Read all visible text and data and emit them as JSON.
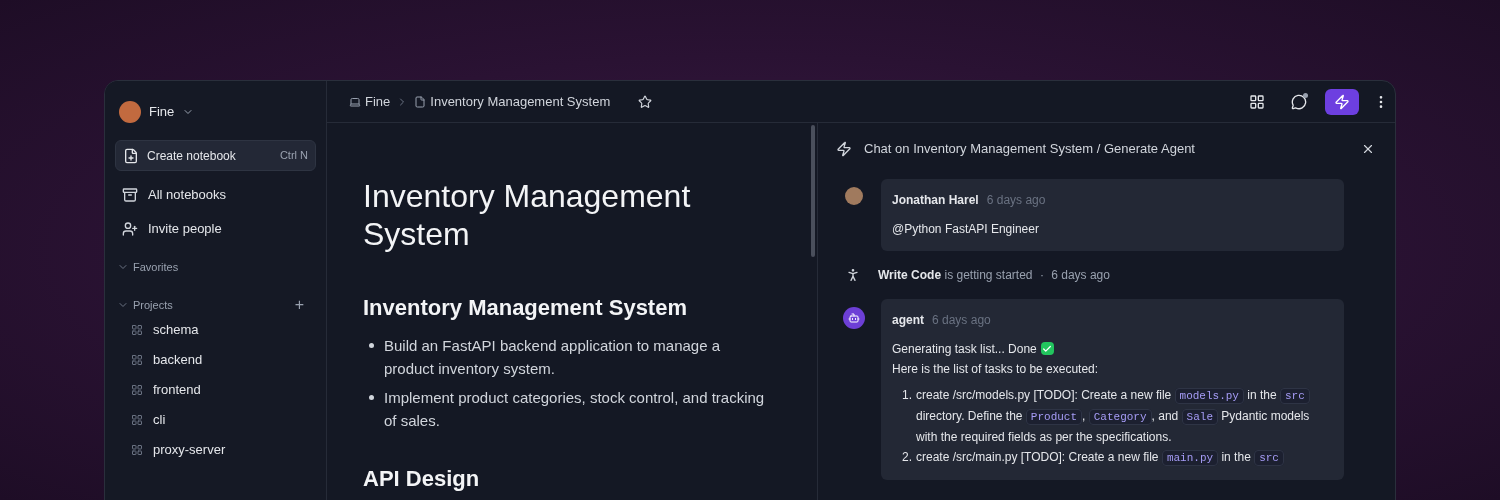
{
  "sidebar": {
    "workspace": "Fine",
    "create_button": {
      "label": "Create notebook",
      "shortcut": "Ctrl N"
    },
    "nav": [
      {
        "label": "All notebooks",
        "kind": "notebooks"
      },
      {
        "label": "Invite people",
        "kind": "invite"
      }
    ],
    "sections": [
      {
        "label": "Favorites",
        "expanded": true
      },
      {
        "label": "Projects",
        "expanded": true,
        "add": "+",
        "items": [
          "schema",
          "backend",
          "frontend",
          "cli",
          "proxy-server"
        ]
      }
    ]
  },
  "breadcrumb": [
    {
      "label": "Fine",
      "kind": "workspace"
    },
    {
      "label": "Inventory Management System",
      "kind": "page"
    }
  ],
  "document": {
    "title": "Inventory Management System",
    "sections": [
      {
        "heading": "Inventory Management System",
        "bullets": [
          "Build an FastAPI backend application to manage a product inventory system.",
          "Implement product categories, stock control, and tracking of sales."
        ]
      },
      {
        "heading": "API Design"
      }
    ]
  },
  "chat": {
    "title": "Chat on Inventory Management System / Generate Agent",
    "entries": [
      {
        "kind": "message",
        "author": "Jonathan Harel",
        "time": "6 days ago",
        "lines": [
          "@Python FastAPI Engineer"
        ]
      },
      {
        "kind": "event",
        "action": "Write Code",
        "text": "is getting started",
        "separator": "·",
        "time": "6 days ago"
      },
      {
        "kind": "agent",
        "author": "agent",
        "time": "6 days ago",
        "lines": [
          "Generating task list... Done",
          "Here is the list of tasks to be executed:"
        ],
        "done": true,
        "tasks": [
          {
            "number": "1.",
            "parts": [
              {
                "kind": "text",
                "text": "create /src/models.py [TODO]: Create a new file "
              },
              {
                "kind": "code",
                "text": "models.py"
              },
              {
                "kind": "text",
                "text": " in the "
              },
              {
                "kind": "code",
                "text": "src"
              },
              {
                "kind": "text",
                "text": " directory. Define the "
              },
              {
                "kind": "code",
                "text": "Product"
              },
              {
                "kind": "text",
                "text": ", "
              },
              {
                "kind": "code",
                "text": "Category"
              },
              {
                "kind": "text",
                "text": ", and "
              },
              {
                "kind": "code",
                "text": "Sale"
              },
              {
                "kind": "text",
                "text": " Pydantic models with the required fields as per the specifications."
              }
            ]
          },
          {
            "number": "2.",
            "parts": [
              {
                "kind": "text",
                "text": "create /src/main.py [TODO]: Create a new file "
              },
              {
                "kind": "code",
                "text": "main.py"
              },
              {
                "kind": "text",
                "text": " in the "
              },
              {
                "kind": "code",
                "text": "src"
              }
            ]
          }
        ]
      }
    ]
  },
  "toolbar": [
    {
      "kind": "grid",
      "selected": false
    },
    {
      "kind": "chat",
      "selected": false,
      "badge": true
    },
    {
      "kind": "bolt",
      "selected": true
    }
  ]
}
